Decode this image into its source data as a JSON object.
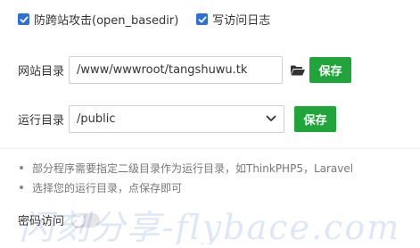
{
  "checkboxes": [
    {
      "label": "防跨站攻击(open_basedir)",
      "checked": true
    },
    {
      "label": "写访问日志",
      "checked": true
    }
  ],
  "site_dir": {
    "label": "网站目录",
    "value": "/www/wwwroot/tangshuwu.tk",
    "folder_icon": "folder-open-icon",
    "save_label": "保存"
  },
  "run_dir": {
    "label": "运行目录",
    "selected": "/public",
    "save_label": "保存"
  },
  "tips": [
    "部分程序需要指定二级目录作为运行目录，如ThinkPHP5，Laravel",
    "选择您的运行目录，点保存即可"
  ],
  "password_access": {
    "label": "密码访问",
    "enabled": false
  },
  "watermark": "闪刻分享-flybace.com",
  "colors": {
    "accent_blue": "#2e6fd8",
    "save_green": "#20a53a",
    "toggle_off": "#e6e6e6"
  }
}
